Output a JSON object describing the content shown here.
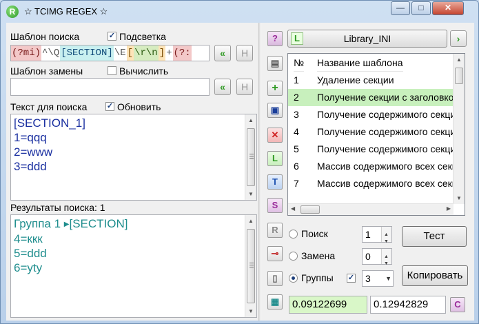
{
  "window": {
    "title": "☆ TCIMG REGEX ☆",
    "app_icon_letter": "R",
    "controls": {
      "minimize": "—",
      "maximize": "□",
      "close": "✕"
    }
  },
  "search_pattern": {
    "label": "Шаблон поиска",
    "highlight_checkbox": {
      "checked": true,
      "label": "Подсветка"
    },
    "tokens": [
      "(?mi)",
      "^\\Q",
      "[SECTION]",
      "\\E",
      "[",
      "\\r\\n",
      "]",
      "+",
      "(?:"
    ]
  },
  "replace_pattern": {
    "label": "Шаблон замены",
    "compute_checkbox": {
      "checked": false,
      "label": "Вычислить"
    },
    "value": ""
  },
  "search_text": {
    "label": "Текст для поиска",
    "refresh_checkbox": {
      "checked": true,
      "label": "Обновить"
    },
    "lines": [
      "[SECTION_1]",
      "1=qqq",
      "2=www",
      "3=ddd"
    ]
  },
  "results": {
    "label": "Результаты поиска: 1",
    "group_prefix": "Группа 1",
    "group_value": "[SECTION]",
    "lines": [
      "4=ккк",
      "5=ddd",
      "6=yty"
    ]
  },
  "library": {
    "button_label": "Library_INI",
    "table": {
      "columns": [
        "№",
        "Название шаблона"
      ],
      "rows": [
        {
          "num": "1",
          "name": "Удаление секции"
        },
        {
          "num": "2",
          "name": "Получение секции с заголовком"
        },
        {
          "num": "3",
          "name": "Получение содержимого секции"
        },
        {
          "num": "4",
          "name": "Получение содержимого секции"
        },
        {
          "num": "5",
          "name": "Получение содержимого секции"
        },
        {
          "num": "6",
          "name": "Массив содержимого всех секций"
        },
        {
          "num": "7",
          "name": "Массив содержимого всех секций"
        }
      ],
      "selected_row": 2
    }
  },
  "modes": {
    "search": {
      "label": "Поиск",
      "selected": false,
      "value": "1"
    },
    "replace": {
      "label": "Замена",
      "selected": false,
      "value": "0"
    },
    "groups": {
      "label": "Группы",
      "selected": true,
      "checkbox_checked": true,
      "combo_value": "3"
    }
  },
  "buttons": {
    "test": "Тест",
    "copy": "Копировать"
  },
  "timings": {
    "first": "0.09122699",
    "second": "0.12942829"
  },
  "toolbar_icons": [
    "help-icon",
    "save-icon",
    "add-icon",
    "edit-icon",
    "delete-icon",
    "library-icon",
    "text-icon",
    "string-icon",
    "regex-icon",
    "pin-icon",
    "page-icon",
    "grid-icon"
  ],
  "colors": {
    "selected_row": "#c8f0bd",
    "timing_box_bg": "#d9f7c8",
    "results_text": "#1e8d8d",
    "search_text": "#1a2fa0"
  }
}
